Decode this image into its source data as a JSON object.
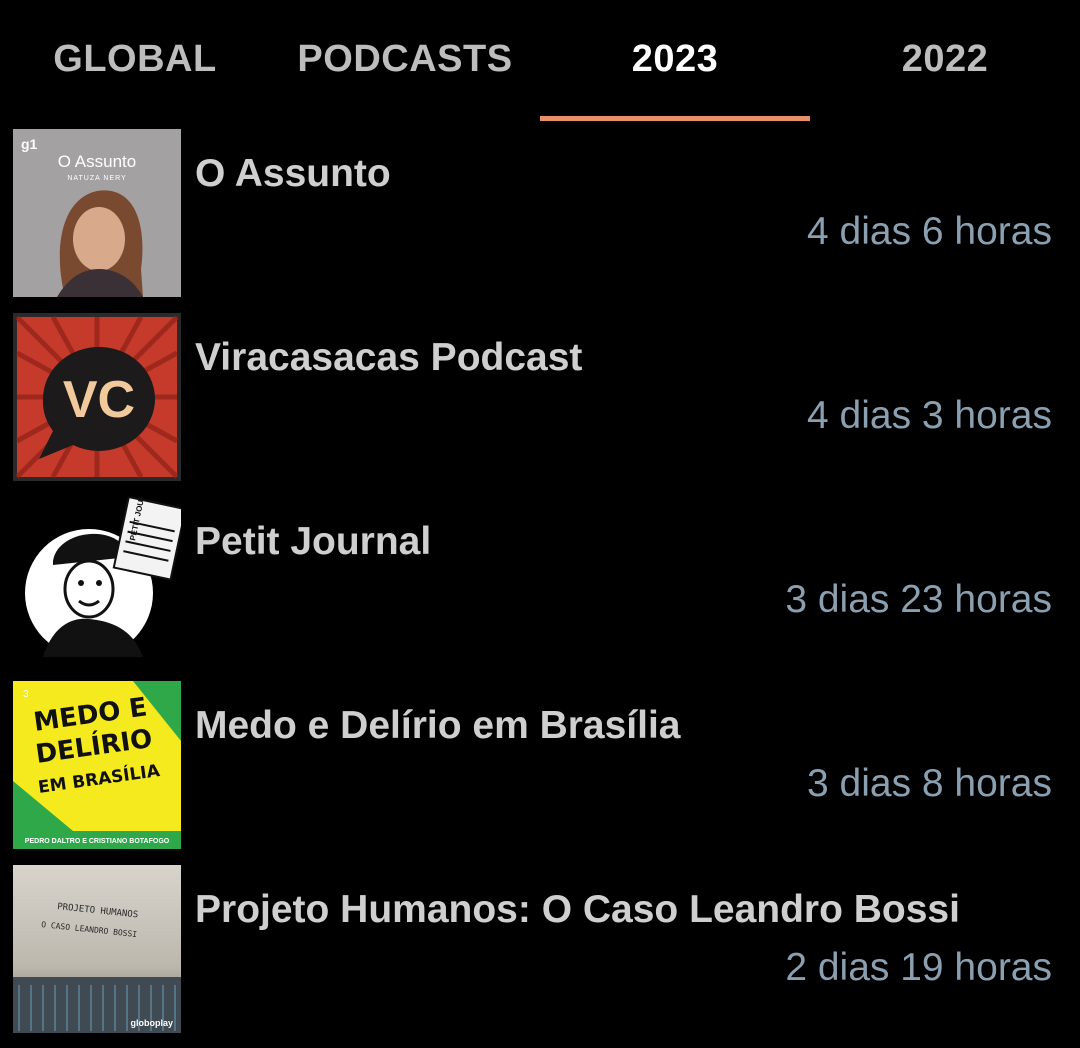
{
  "tabs": [
    {
      "label": "GLOBAL",
      "active": false
    },
    {
      "label": "PODCASTS",
      "active": false
    },
    {
      "label": "2023",
      "active": true
    },
    {
      "label": "2022",
      "active": false
    }
  ],
  "accent_color": "#e8906a",
  "podcasts": [
    {
      "title": "O Assunto",
      "duration": "4 dias 6 horas",
      "art": {
        "brand": "g1",
        "name": "O Assunto",
        "host": "NATUZA NERY"
      }
    },
    {
      "title": "Viracasacas Podcast",
      "duration": "4 dias 3 horas",
      "art": {
        "logo": "VC"
      }
    },
    {
      "title": "Petit Journal",
      "duration": "3 dias 23 horas",
      "art": {
        "paper": "PETIT JOURNAL"
      }
    },
    {
      "title": "Medo e Delírio em Brasília",
      "duration": "3 dias 8 horas",
      "art": {
        "line1": "MEDO E",
        "line2": "DELÍRIO",
        "line3": "EM BRASÍLIA",
        "credits": "PEDRO DALTRO E CRISTIANO BOTAFOGO"
      }
    },
    {
      "title": "Projeto Humanos: O Caso Leandro Bossi",
      "duration": "2 dias 19 horas",
      "art": {
        "line1": "PROJETO HUMANOS",
        "line2": "O CASO LEANDRO BOSSI",
        "brand": "globoplay"
      }
    }
  ]
}
